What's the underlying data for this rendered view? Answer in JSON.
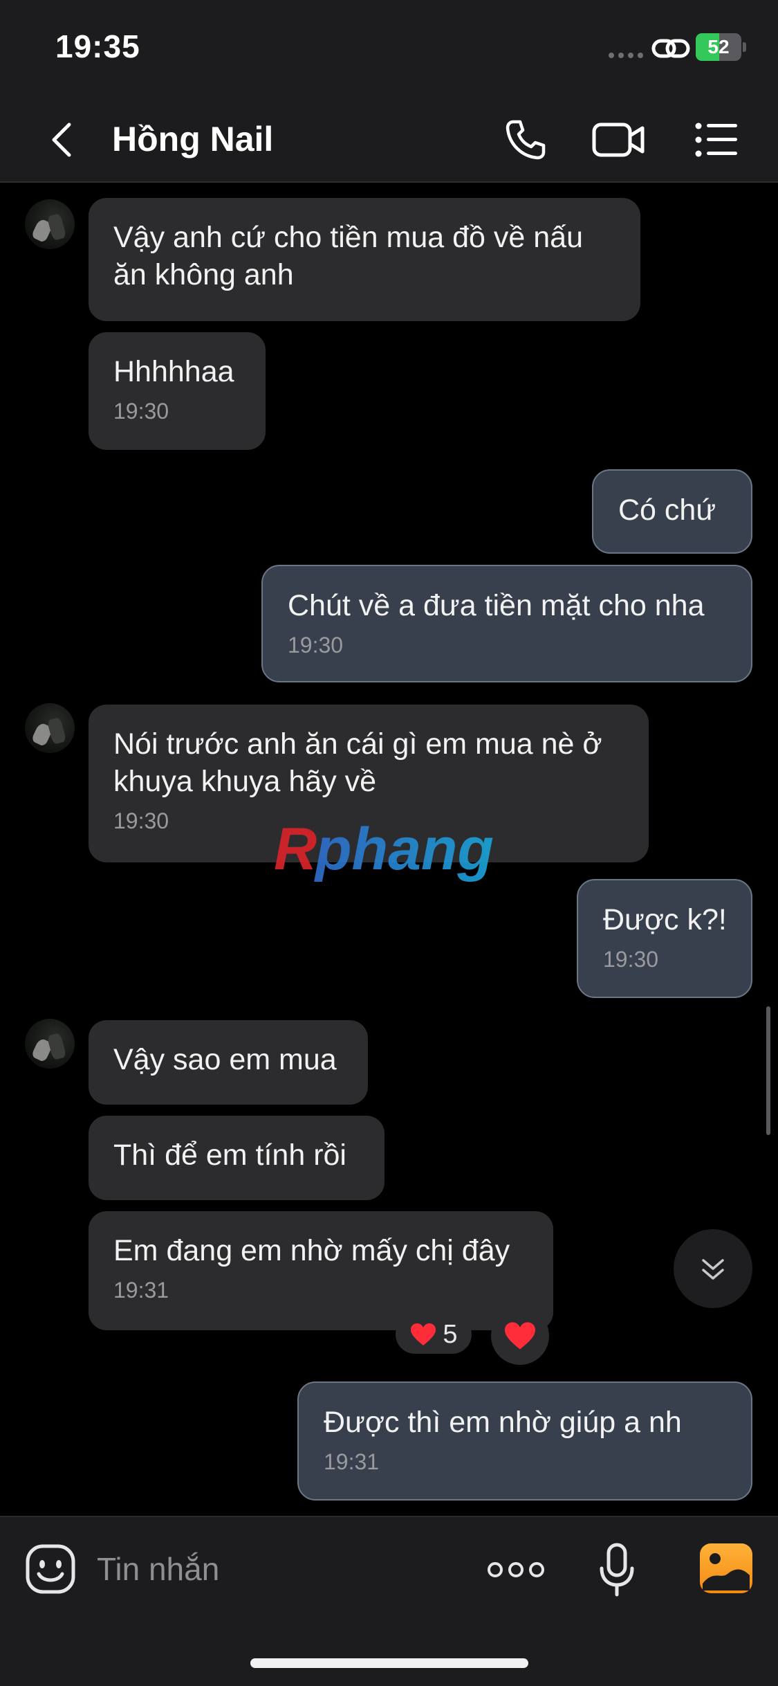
{
  "status_bar": {
    "time": "19:35",
    "battery": "52",
    "battery_level": 0.52
  },
  "header": {
    "contact_name": "Hồng Nail",
    "icons": [
      "back-chevron-icon",
      "phone-icon",
      "video-camera-icon",
      "list-menu-icon"
    ]
  },
  "messages": [
    {
      "from": "contact",
      "text_lines": [
        "Vậy anh cứ cho tiền mua đồ về nấu",
        "ăn không anh"
      ],
      "time": ""
    },
    {
      "from": "contact",
      "text_lines": [
        "Hhhhhaa"
      ],
      "time": "19:30"
    },
    {
      "from": "me",
      "text_lines": [
        "Có chứ"
      ],
      "time": ""
    },
    {
      "from": "me",
      "text_lines": [
        "Chút về a đưa tiền mặt cho nha"
      ],
      "time": "19:30"
    },
    {
      "from": "contact",
      "text_lines": [
        "Nói trước anh ăn cái gì em mua nè ở",
        "khuya khuya hãy về"
      ],
      "time": "19:30"
    },
    {
      "from": "me",
      "text_lines": [
        "Được k?!"
      ],
      "time": "19:30"
    },
    {
      "from": "contact",
      "text_lines": [
        "Vậy sao em mua"
      ],
      "time": ""
    },
    {
      "from": "contact",
      "text_lines": [
        "Thì để em tính rồi"
      ],
      "time": ""
    },
    {
      "from": "contact",
      "text_lines": [
        "Em đang em nhờ mấy chị đây"
      ],
      "time": "19:31"
    },
    {
      "from": "me",
      "text_lines": [
        "Được thì em nhờ giúp a nh"
      ],
      "time": "19:31"
    }
  ],
  "reaction": {
    "emoji": "❤️",
    "count": "5",
    "heart_color": "#ff2d3a"
  },
  "watermark": {
    "text": "Rphang"
  },
  "input_bar": {
    "placeholder": "Tin nhắn",
    "icons": [
      "emoji-icon",
      "more-dots-icon",
      "microphone-icon",
      "image-icon"
    ]
  },
  "colors": {
    "background": "#000000",
    "bar": "#1c1c1e",
    "incoming_bubble": "#2c2c2e",
    "outgoing_bubble": "#38404d",
    "outgoing_border": "#6b7687",
    "battery": "#34c759"
  }
}
